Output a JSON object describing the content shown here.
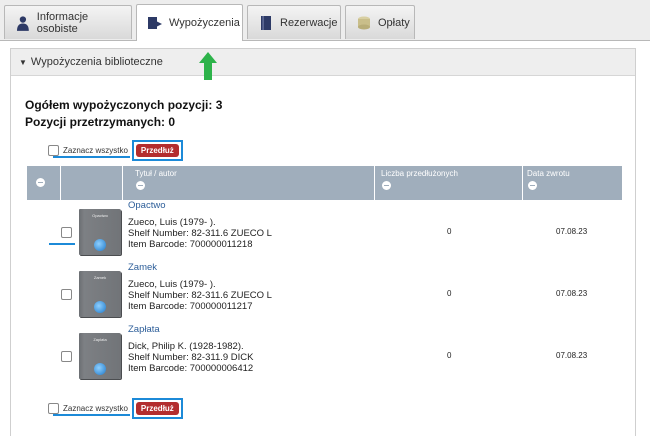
{
  "tabs": [
    {
      "label": "Informacje osobiste",
      "icon": "person-icon"
    },
    {
      "label": "Wypożyczenia",
      "icon": "book-arrow-icon",
      "active": true
    },
    {
      "label": "Rezerwacje",
      "icon": "book-icon"
    },
    {
      "label": "Opłaty",
      "icon": "coins-icon"
    }
  ],
  "panel": {
    "title": "Wypożyczenia biblioteczne"
  },
  "summary": {
    "total": "Ogółem wypożyczonych pozycji: 3",
    "held": "Pozycji przetrzymanych: 0"
  },
  "select_all_label": "Zaznacz wszystko",
  "renew_label": "Przedłuż",
  "columns": {
    "title_author": "Tytuł / autor",
    "renewals": "Liczba przedłużonych",
    "due_date": "Data zwrotu"
  },
  "items": [
    {
      "cover_title": "Opactwo",
      "title": "Opactwo",
      "author": "Zueco, Luis (1979- ).",
      "shelf": "Shelf Number: 82-311.6 ZUECO L",
      "barcode": "Item Barcode: 700000011218",
      "renewals": "0",
      "due": "07.08.23"
    },
    {
      "cover_title": "Zamek",
      "title": "Zamek",
      "author": "Zueco, Luis (1979- ).",
      "shelf": "Shelf Number: 82-311.6 ZUECO L",
      "barcode": "Item Barcode: 700000011217",
      "renewals": "0",
      "due": "07.08.23"
    },
    {
      "cover_title": "Zapłata",
      "title": "Zapłata",
      "author": "Dick, Philip K. (1928-1982).",
      "shelf": "Shelf Number: 82-311.9 DICK",
      "barcode": "Item Barcode: 700000006412",
      "renewals": "0",
      "due": "07.08.23"
    }
  ],
  "colors": {
    "accent_blue": "#1c8ad8",
    "renew_red": "#b32d2e",
    "header_gray": "#a0aebc",
    "arrow_green": "#2db34a"
  }
}
